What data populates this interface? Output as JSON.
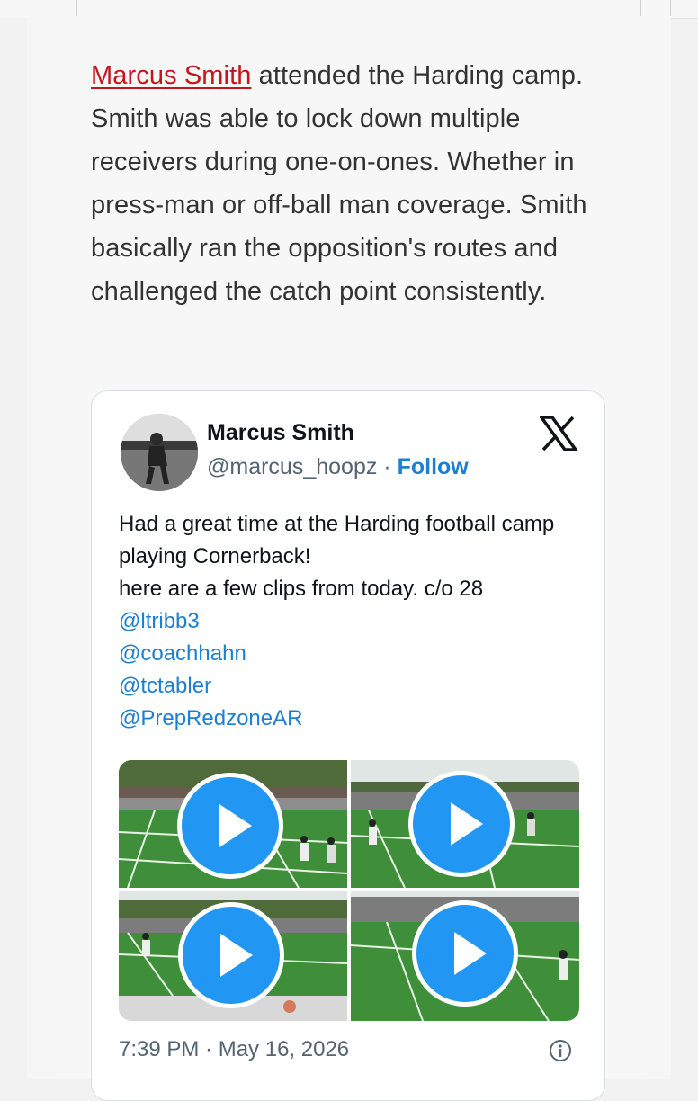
{
  "article": {
    "link_name": "Marcus Smith",
    "body_text": " attended the Harding camp. Smith was able to lock down multiple receivers during one-on-ones. Whether in press-man or off-ball man coverage. Smith basically ran the opposition's routes and challenged the catch point consistently."
  },
  "tweet": {
    "author_name": "Marcus Smith",
    "handle": "@marcus_hoopz",
    "separator": " · ",
    "follow_label": "Follow",
    "text_lines": [
      "Had a great time at the Harding football camp playing Cornerback!",
      "here are a few clips from today. c/o 28"
    ],
    "mentions": [
      "@ltribb3",
      "@coachhahn",
      "@tctabler",
      "@PrepRedzoneAR"
    ],
    "timestamp": "7:39 PM · May 16, 2026",
    "media_count": 4,
    "icons": [
      "x-logo-icon",
      "play-icon",
      "info-icon"
    ],
    "colors": {
      "link_red": "#c4161c",
      "twitter_blue": "#1d7fd1",
      "play_blue": "#2196f3"
    }
  }
}
